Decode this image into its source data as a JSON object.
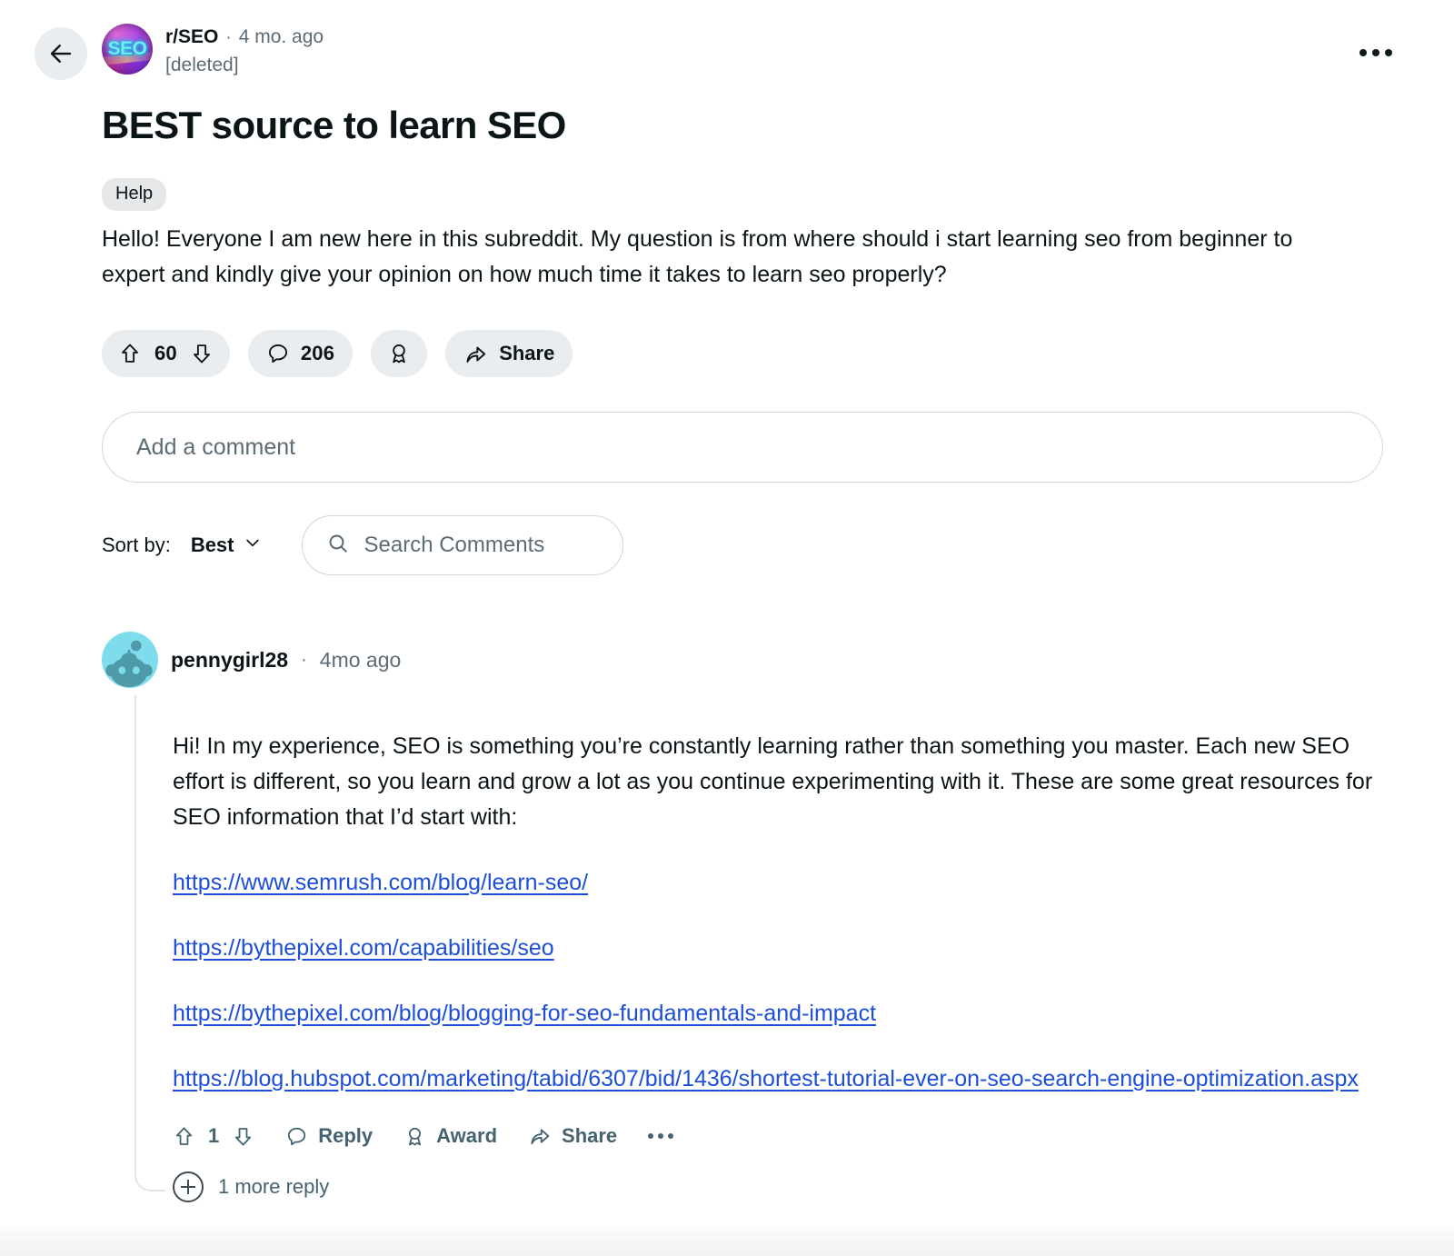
{
  "nav": {
    "back_icon": "arrow-left-icon",
    "overflow_icon": "more-horizontal-icon"
  },
  "post": {
    "subreddit": "r/SEO",
    "separator": "·",
    "time_ago": "4 mo. ago",
    "author": "[deleted]",
    "avatar_text": "SEO",
    "title": "BEST source to learn SEO",
    "flair": "Help",
    "body": "Hello! Everyone I am new here in this subreddit. My question is from where should i start learning seo from beginner to expert and kindly give your opinion on how much time it takes to learn seo properly?",
    "actions": {
      "upvote_icon": "upvote-arrow-icon",
      "score": "60",
      "downvote_icon": "downvote-arrow-icon",
      "comment_icon": "comment-bubble-icon",
      "comment_count": "206",
      "award_icon": "award-ribbon-icon",
      "share_icon": "share-arrow-icon",
      "share_label": "Share"
    }
  },
  "composer": {
    "placeholder": "Add a comment"
  },
  "sort": {
    "label": "Sort by:",
    "selected": "Best",
    "chevron_icon": "chevron-down-icon",
    "search_icon": "search-icon",
    "search_placeholder": "Search Comments"
  },
  "comment": {
    "author": "pennygirl28",
    "separator": "·",
    "time_ago": "4mo ago",
    "text": "Hi! In my experience, SEO is something you’re constantly learning rather than something you master. Each new SEO effort is different, so you learn and grow a lot as you continue experimenting with it. These are some great resources for SEO information that I’d start with:",
    "links": [
      "https://www.semrush.com/blog/learn-seo/",
      "https://bythepixel.com/capabilities/seo",
      "https://bythepixel.com/blog/blogging-for-seo-fundamentals-and-impact",
      "https://blog.hubspot.com/marketing/tabid/6307/bid/1436/shortest-tutorial-ever-on-seo-search-engine-optimization.aspx"
    ],
    "actions": {
      "upvote_icon": "upvote-arrow-icon",
      "score": "1",
      "downvote_icon": "downvote-arrow-icon",
      "reply_icon": "comment-bubble-icon",
      "reply_label": "Reply",
      "award_icon": "award-ribbon-icon",
      "award_label": "Award",
      "share_icon": "share-arrow-icon",
      "share_label": "Share",
      "overflow_icon": "more-horizontal-icon"
    },
    "more_replies": "1 more reply",
    "expand_icon": "plus-circle-icon"
  },
  "colors": {
    "link": "#1d4ed8",
    "pill_bg": "#eaedef",
    "muted_text": "#5c6c74",
    "action_text": "#44626f",
    "avatar_bg": "#7fdcec"
  }
}
